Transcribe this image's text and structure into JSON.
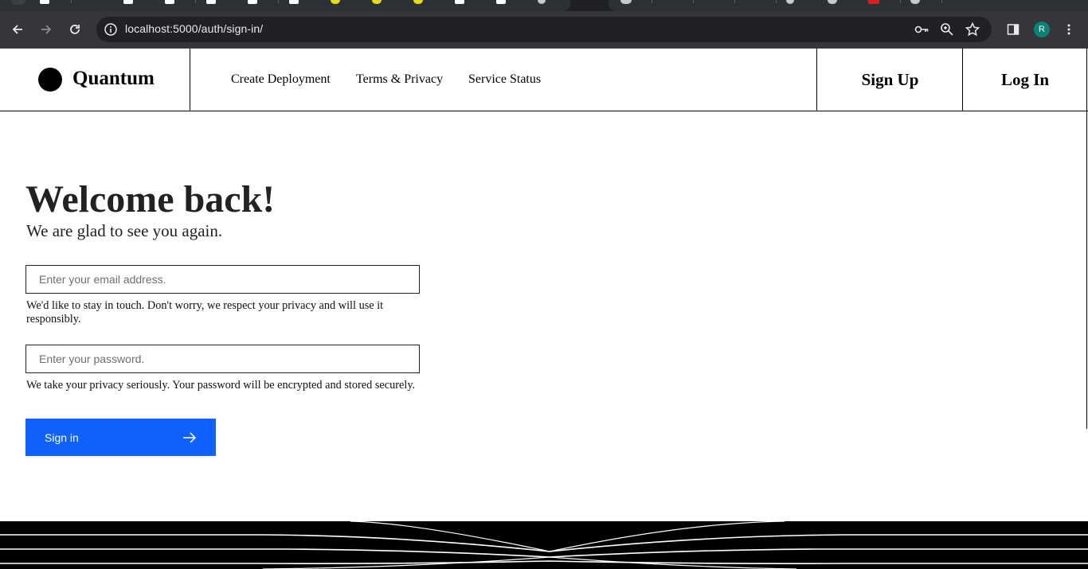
{
  "browser": {
    "url": "localhost:5000/auth/sign-in/",
    "profile_initial": "R",
    "nav": {
      "back_icon": "arrow-left-icon",
      "forward_icon": "arrow-right-icon",
      "reload_icon": "reload-icon"
    },
    "omnibox_icons": [
      "info-icon",
      "key-icon",
      "zoom-icon",
      "star-icon"
    ]
  },
  "header": {
    "brand": "Quantum",
    "nav_links": [
      "Create Deployment",
      "Terms & Privacy",
      "Service Status"
    ],
    "sign_up": "Sign Up",
    "log_in": "Log In"
  },
  "main": {
    "title": "Welcome back!",
    "subtitle": "We are glad to see you again.",
    "email": {
      "placeholder": "Enter your email address.",
      "value": "",
      "helper": "We'd like to stay in touch. Don't worry, we respect your privacy and will use it responsibly."
    },
    "password": {
      "placeholder": "Enter your password.",
      "value": "",
      "helper": "We take your privacy seriously. Your password will be encrypted and stored securely."
    },
    "submit": {
      "label": "Sign in",
      "icon": "arrow-right-icon"
    }
  },
  "colors": {
    "primary": "#0f62fe",
    "text": "#222222",
    "chrome_dark": "#35363a",
    "omnibox": "#202124",
    "avatar": "#0b8374"
  }
}
